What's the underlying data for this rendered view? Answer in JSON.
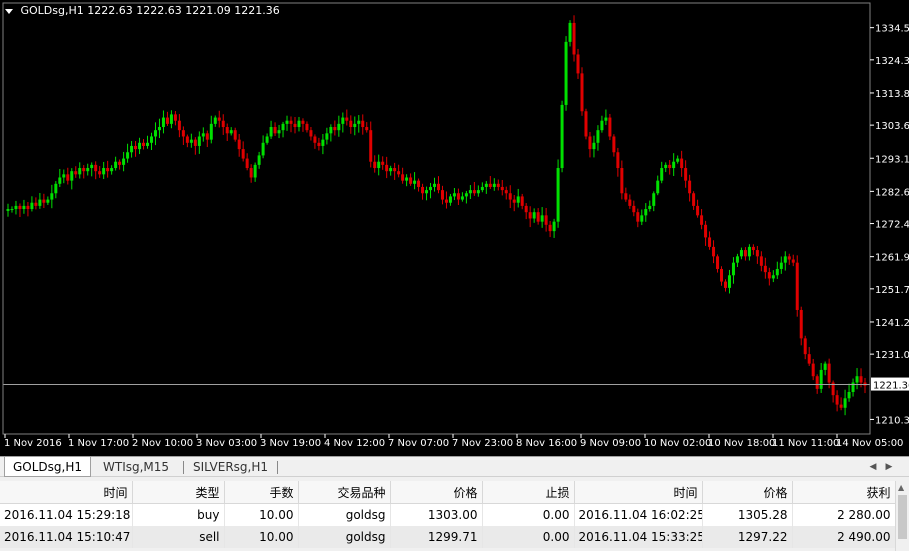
{
  "chart": {
    "symbol": "GOLDsg,H1",
    "ohlc": "1222.63 1222.63 1221.09 1221.36",
    "bid_price": "1221.36",
    "price_labels": [
      "1334.50",
      "1324.30",
      "1313.80",
      "1303.60",
      "1293.10",
      "1282.60",
      "1272.40",
      "1261.90",
      "1251.70",
      "1241.20",
      "1231.00",
      "1210.30"
    ],
    "time_labels": [
      "1 Nov 2016",
      "1 Nov 17:00",
      "2 Nov 10:00",
      "3 Nov 03:00",
      "3 Nov 19:00",
      "4 Nov 12:00",
      "7 Nov 07:00",
      "7 Nov 23:00",
      "8 Nov 16:00",
      "9 Nov 09:00",
      "10 Nov 02:00",
      "10 Nov 18:00",
      "11 Nov 11:00",
      "14 Nov 05:00"
    ],
    "colors": {
      "background": "#000000",
      "bull": "#00e000",
      "bear": "#e00000",
      "text": "#ffffff",
      "bid_line": "#a0a0a0"
    }
  },
  "chart_data": {
    "type": "candlestick",
    "ylim": [
      1206,
      1342
    ],
    "closes": [
      1277,
      1277,
      1278,
      1277,
      1278,
      1277,
      1279,
      1278,
      1280,
      1279,
      1280,
      1282,
      1285,
      1287,
      1288,
      1286,
      1289,
      1288,
      1290,
      1289,
      1290,
      1291,
      1289,
      1288,
      1290,
      1289,
      1290,
      1292,
      1291,
      1293,
      1295,
      1297,
      1296,
      1298,
      1297,
      1298,
      1300,
      1302,
      1303,
      1306,
      1304,
      1307,
      1305,
      1302,
      1300,
      1298,
      1299,
      1297,
      1300,
      1301,
      1299,
      1304,
      1306,
      1305,
      1303,
      1301,
      1302,
      1299,
      1296,
      1293,
      1290,
      1287,
      1291,
      1294,
      1298,
      1300,
      1303,
      1301,
      1302,
      1304,
      1305,
      1304,
      1303,
      1305,
      1304,
      1302,
      1300,
      1298,
      1297,
      1299,
      1301,
      1303,
      1302,
      1304,
      1306,
      1305,
      1303,
      1304,
      1305,
      1303,
      1302,
      1292,
      1290,
      1292,
      1291,
      1289,
      1290,
      1289,
      1288,
      1286,
      1287,
      1285,
      1286,
      1284,
      1282,
      1283,
      1284,
      1285,
      1283,
      1280,
      1279,
      1281,
      1282,
      1280,
      1281,
      1282,
      1283,
      1282,
      1283,
      1284,
      1285,
      1284,
      1285,
      1284,
      1283,
      1282,
      1280,
      1279,
      1281,
      1278,
      1276,
      1274,
      1276,
      1273,
      1275,
      1272,
      1270,
      1273,
      1290,
      1310,
      1330,
      1336,
      1326,
      1320,
      1308,
      1300,
      1296,
      1298,
      1302,
      1305,
      1306,
      1300,
      1295,
      1290,
      1282,
      1280,
      1278,
      1276,
      1273,
      1275,
      1277,
      1278,
      1282,
      1286,
      1290,
      1291,
      1290,
      1292,
      1293,
      1290,
      1286,
      1282,
      1278,
      1275,
      1272,
      1268,
      1265,
      1262,
      1258,
      1254,
      1252,
      1256,
      1260,
      1262,
      1264,
      1262,
      1265,
      1264,
      1262,
      1259,
      1257,
      1255,
      1256,
      1258,
      1260,
      1262,
      1261,
      1260,
      1245,
      1236,
      1231,
      1228,
      1224,
      1220,
      1226,
      1228,
      1222,
      1218,
      1215,
      1214,
      1217,
      1219,
      1222,
      1224,
      1222,
      1221
    ]
  },
  "tabs": [
    {
      "label": "GOLDsg,H1"
    },
    {
      "label": "WTIsg,M15"
    },
    {
      "label": "SILVERsg,H1"
    }
  ],
  "table": {
    "headers": [
      "时间",
      "类型",
      "手数",
      "交易品种",
      "价格",
      "止损",
      "时间",
      "价格",
      "获利"
    ],
    "rows": [
      [
        "2016.11.04 15:29:18",
        "buy",
        "10.00",
        "goldsg",
        "1303.00",
        "0.00",
        "2016.11.04 16:02:25",
        "1305.28",
        "2 280.00"
      ],
      [
        "2016.11.04 15:10:47",
        "sell",
        "10.00",
        "goldsg",
        "1299.71",
        "0.00",
        "2016.11.04 15:33:25",
        "1297.22",
        "2 490.00"
      ]
    ]
  },
  "icons": {
    "left_arrow": "arrow-left-icon",
    "right_arrow": "arrow-right-icon",
    "dropdown": "triangle-down-icon"
  }
}
